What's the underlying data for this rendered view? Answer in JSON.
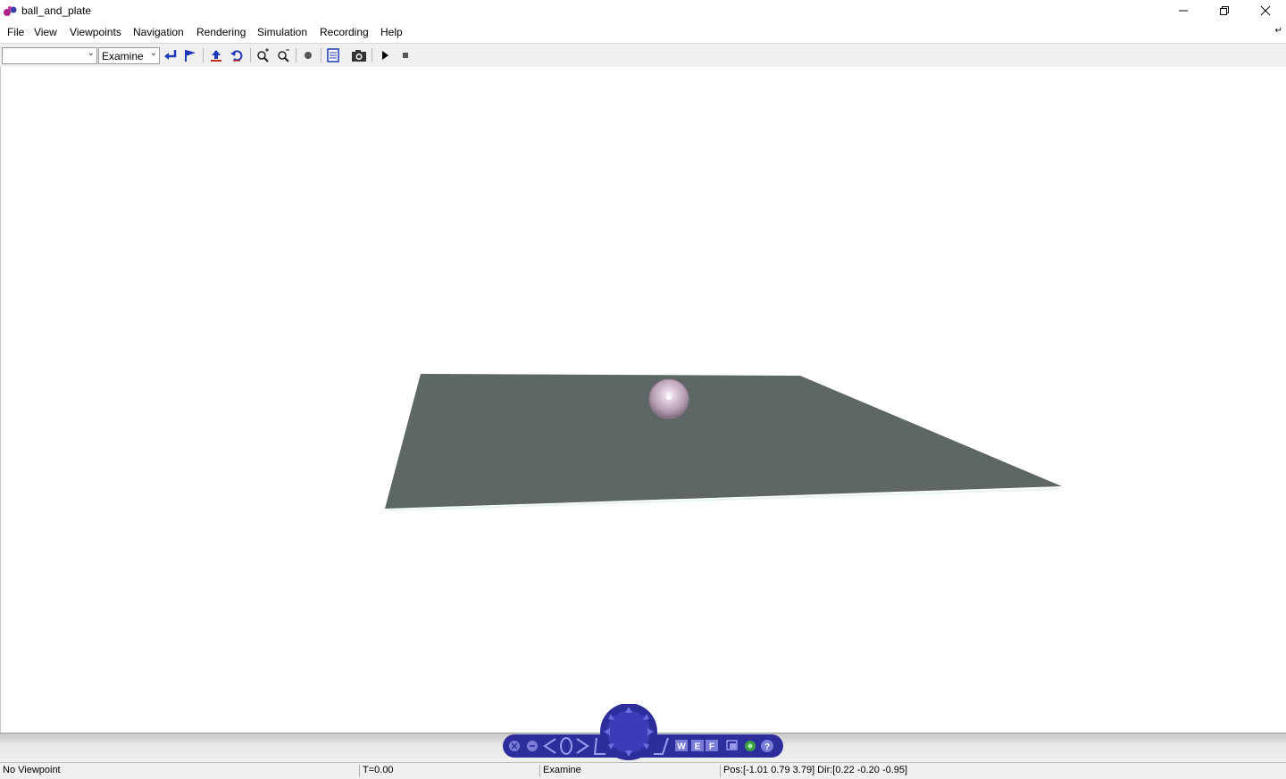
{
  "window": {
    "title": "ball_and_plate"
  },
  "menu": [
    "File",
    "View",
    "Viewpoints",
    "Navigation",
    "Rendering",
    "Simulation",
    "Recording",
    "Help"
  ],
  "toolbar": {
    "viewpoint_select": "",
    "navigation_mode": "Examine"
  },
  "navigator": {
    "buttons": [
      "W",
      "E",
      "F",
      "?"
    ]
  },
  "status": {
    "viewpoint": "No Viewpoint",
    "time": "T=0.00",
    "mode": "Examine",
    "position": "Pos:[-1.01 0.79 3.79] Dir:[0.22 -0.20 -0.95]"
  },
  "colors": {
    "plate": "#5e6666",
    "ball": "#c9b3c6",
    "nav": "#2d2e9c",
    "toolbar_icon": "#1f39b8"
  }
}
